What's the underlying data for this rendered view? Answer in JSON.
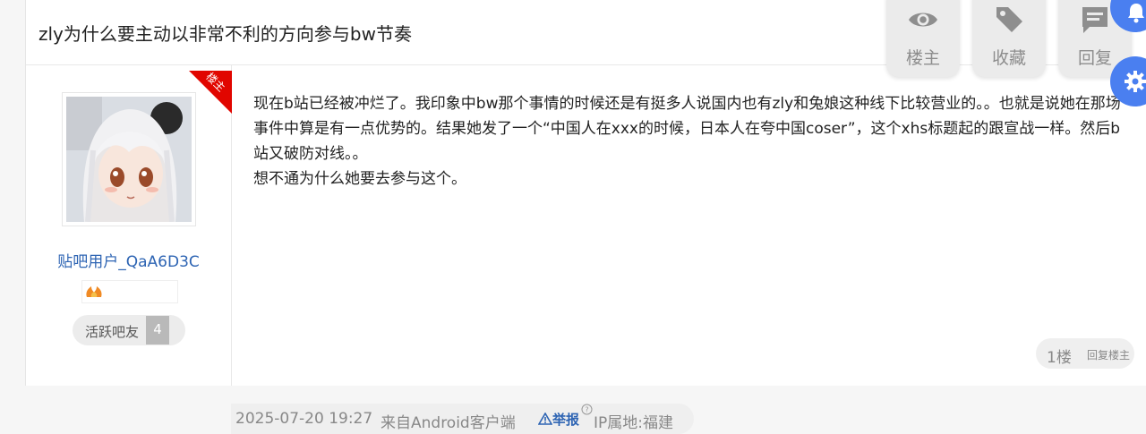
{
  "thread": {
    "title": "zly为什么要主动以非常不利的方向参与bw节奏"
  },
  "actions": [
    {
      "label": "楼主",
      "icon": "eye-icon"
    },
    {
      "label": "收藏",
      "icon": "tag-icon"
    },
    {
      "label": "回复",
      "icon": "comment-icon"
    }
  ],
  "side_buttons": [
    {
      "icon": "bell-icon"
    },
    {
      "icon": "gear-icon"
    }
  ],
  "author": {
    "corner_badge": "楼主",
    "username": "贴吧用户_QaA6D3C",
    "active_label": "活跃吧友",
    "level": "4"
  },
  "post": {
    "paragraphs": [
      "现在b站已经被冲烂了。我印象中bw那个事情的时候还是有挺多人说国内也有zly和兔娘这种线下比较营业的。。也就是说她在那场事件中算是有一点优势的。结果她发了一个“中国人在xxx的时候，日本人在夸中国coser”，这个xhs标题起的跟宣战一样。然后b站又破防对线。。",
      "想不通为什么她要去参与这个。"
    ]
  },
  "meta": {
    "datetime": "2025-07-20 19:27",
    "source": "来自Android客户端",
    "report_label": "举报",
    "ip_location": "IP属地:福建"
  },
  "floor": {
    "number": "1楼",
    "reply_owner": "回复楼主"
  },
  "colors": {
    "accent": "#4a7ff0",
    "username": "#2d64b3",
    "corner_badge": "#e10600",
    "report": "#2d64b3"
  }
}
